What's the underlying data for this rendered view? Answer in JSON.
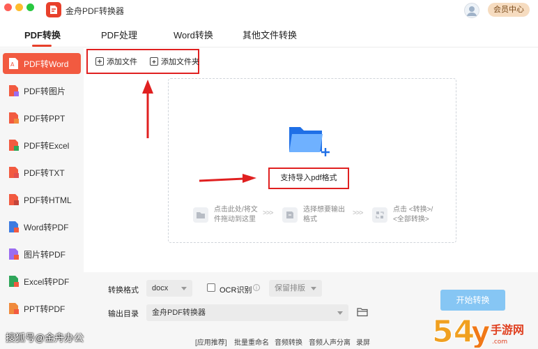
{
  "app": {
    "title": "金舟PDF转换器",
    "vip_label": "会员中心"
  },
  "tabs": [
    {
      "label": "PDF转换",
      "active": true
    },
    {
      "label": "PDF处理"
    },
    {
      "label": "Word转换"
    },
    {
      "label": "其他文件转换"
    }
  ],
  "sidebar": {
    "items": [
      {
        "label": "PDF转Word",
        "icon": "pdf-word-icon",
        "active": true
      },
      {
        "label": "PDF转图片",
        "icon": "pdf-image-icon"
      },
      {
        "label": "PDF转PPT",
        "icon": "pdf-ppt-icon"
      },
      {
        "label": "PDF转Excel",
        "icon": "pdf-excel-icon"
      },
      {
        "label": "PDF转TXT",
        "icon": "pdf-txt-icon"
      },
      {
        "label": "PDF转HTML",
        "icon": "pdf-html-icon"
      },
      {
        "label": "Word转PDF",
        "icon": "word-pdf-icon"
      },
      {
        "label": "图片转PDF",
        "icon": "image-pdf-icon"
      },
      {
        "label": "Excel转PDF",
        "icon": "excel-pdf-icon"
      },
      {
        "label": "PPT转PDF",
        "icon": "ppt-pdf-icon"
      }
    ]
  },
  "toolbar": {
    "add_file": "添加文件",
    "add_folder": "添加文件夹"
  },
  "dropzone": {
    "support_label": "支持导入pdf格式",
    "steps": [
      {
        "line1": "点击此处/将文",
        "line2": "件拖动到这里"
      },
      {
        "line1": "选择想要输出",
        "line2": "格式"
      },
      {
        "line1": "点击 <转换>/",
        "line2": "<全部转换>"
      }
    ],
    "chevron": ">>>"
  },
  "settings": {
    "format_label": "转换格式",
    "format_value": "docx",
    "ocr_label": "OCR识别",
    "ocr_checked": false,
    "layout_value": "保留排版",
    "output_label": "输出目录",
    "output_value": "金舟PDF转换器",
    "start_label": "开始转换"
  },
  "footer": {
    "links": [
      "[应用推荐]",
      "批量重命名",
      "音频转换",
      "音频人声分离",
      "录屏"
    ]
  },
  "watermarks": {
    "left": "搜狐号@金舟办公"
  },
  "colors": {
    "accent": "#f25a40",
    "annotation": "#e02020",
    "start_button": "#86c6f4",
    "vip": "#f6dcc0"
  }
}
